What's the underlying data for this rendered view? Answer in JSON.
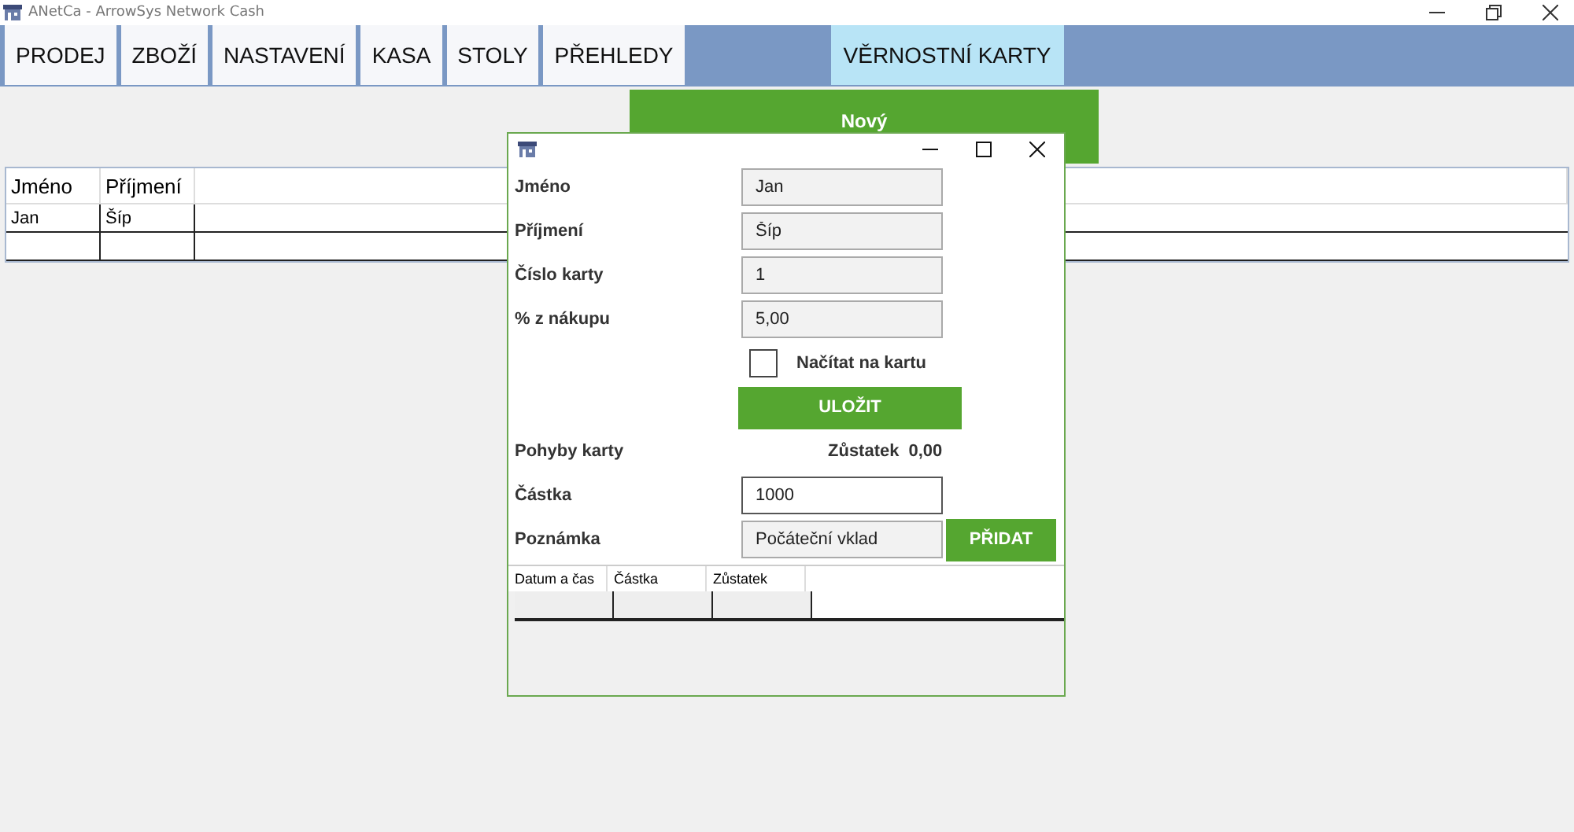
{
  "window": {
    "title": "ANetCa - ArrowSys Network Cash"
  },
  "tabs": [
    {
      "label": "PRODEJ",
      "selected": false
    },
    {
      "label": "ZBOŽÍ",
      "selected": false
    },
    {
      "label": "NASTAVENÍ",
      "selected": false
    },
    {
      "label": "KASA",
      "selected": false
    },
    {
      "label": "STOLY",
      "selected": false
    },
    {
      "label": "PŘEHLEDY",
      "selected": false
    },
    {
      "label": "VĚRNOSTNÍ KARTY",
      "selected": true
    }
  ],
  "new_button": "Nový",
  "table": {
    "columns": [
      "Jméno",
      "Příjmení"
    ],
    "rows": [
      [
        "Jan",
        "Šíp"
      ],
      [
        "",
        ""
      ]
    ]
  },
  "dialog": {
    "fields": [
      {
        "label": "Jméno",
        "value": "Jan"
      },
      {
        "label": "Příjmení",
        "value": "Šíp"
      },
      {
        "label": "Číslo karty",
        "value": "1"
      },
      {
        "label": "% z nákupu",
        "value": "5,00"
      }
    ],
    "checkbox": {
      "label": "Načítat na kartu",
      "checked": false
    },
    "save_button": "ULOŽIT",
    "movements_label": "Pohyby karty",
    "balance_label": "Zůstatek",
    "balance_value": "0,00",
    "amount": {
      "label": "Částka",
      "value": "1000"
    },
    "note": {
      "label": "Poznámka",
      "value": "Počáteční vklad"
    },
    "add_button": "PŘIDAT",
    "grid_columns": [
      "Datum a čas",
      "Částka",
      "Zůstatek"
    ]
  }
}
